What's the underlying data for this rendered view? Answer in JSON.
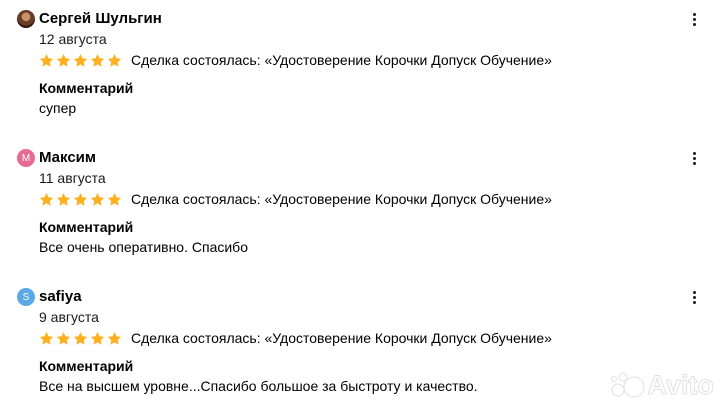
{
  "reviews": [
    {
      "author": "Сергей Шульгин",
      "avatar": "photo",
      "avatar_color": "#4a2c1c",
      "date": "12 августа",
      "rating": 5,
      "deal": "Сделка состоялась: «Удостоверение Корочки Допуск Обучение»",
      "comment_label": "Комментарий",
      "comment": "супер"
    },
    {
      "author": "Максим",
      "avatar": "М",
      "avatar_color": "#e56b93",
      "date": "11 августа",
      "rating": 5,
      "deal": "Сделка состоялась: «Удостоверение Корочки Допуск Обучение»",
      "comment_label": "Комментарий",
      "comment": "Все очень оперативно. Спасибо"
    },
    {
      "author": "safiya",
      "avatar": "S",
      "avatar_color": "#5aa8e6",
      "date": "9 августа",
      "rating": 5,
      "deal": "Сделка состоялась: «Удостоверение Корочки Допуск Обучение»",
      "comment_label": "Комментарий",
      "comment": "Все на высшем уровне...Спасибо большое за быстроту и качество."
    }
  ],
  "icons": {
    "more": "more-vertical-icon",
    "star": "star-icon",
    "watermark": "avito-logo-icon"
  },
  "colors": {
    "star": "#ffb021",
    "text": "#000000"
  },
  "watermark": {
    "text": "Avito"
  }
}
